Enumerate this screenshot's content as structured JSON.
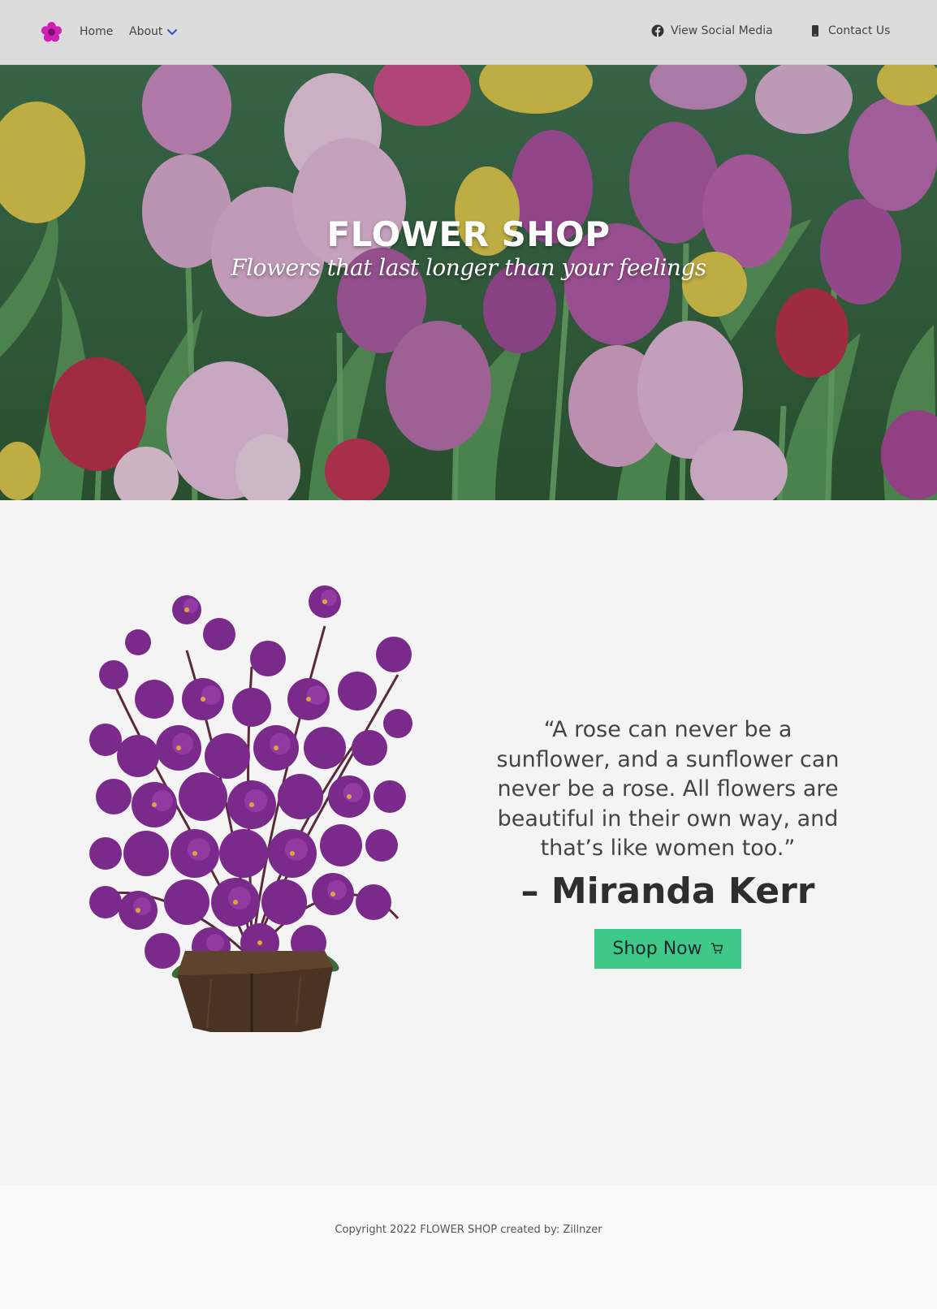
{
  "nav": {
    "logo_icon": "flower-logo-icon",
    "home_label": "Home",
    "about_label": "About",
    "social_label": "View Social Media",
    "contact_label": "Contact Us",
    "about_chevron_color": "#3a55c9"
  },
  "hero": {
    "title": "FLOWER SHOP",
    "subtitle": "Flowers that last longer than your feelings"
  },
  "main": {
    "quote": "“A rose can never be a sunflower, and a sunflower can never be a rose. All flowers are beautiful in their own way, and that’s like women too.”",
    "author": "– Miranda Kerr",
    "shop_button_label": "Shop Now",
    "shop_button_color": "#3ec98b"
  },
  "footer": {
    "copyright": "Copyright 2022 FLOWER SHOP created by: Zillnzer"
  }
}
